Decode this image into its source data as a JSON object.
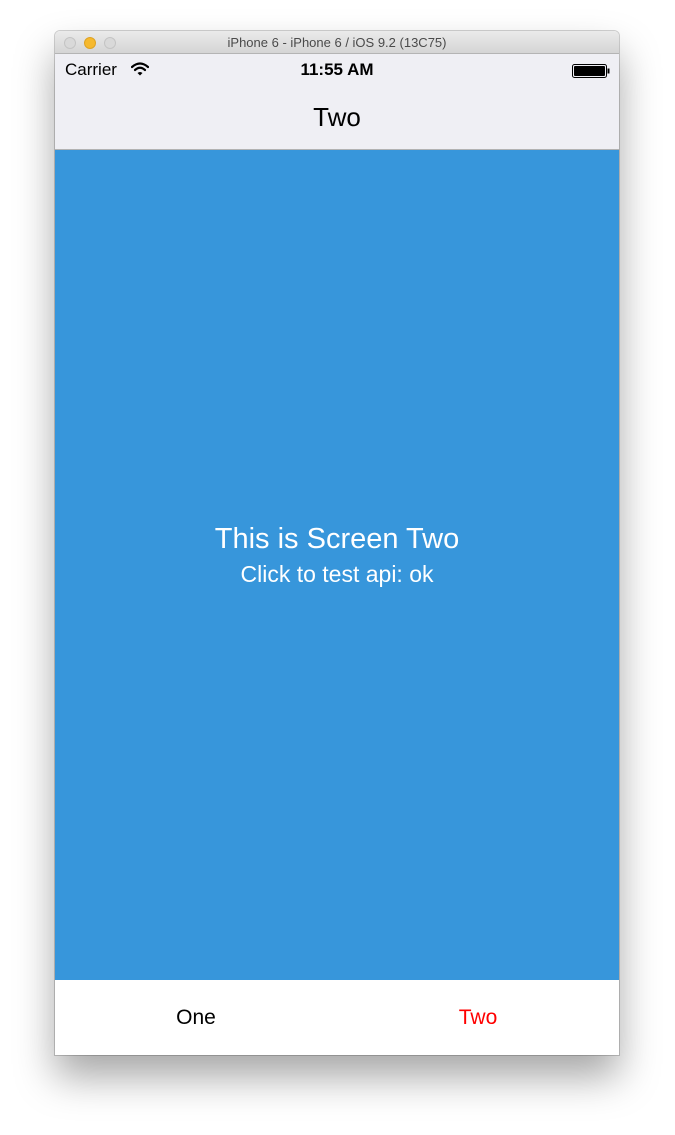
{
  "window": {
    "title": "iPhone 6 - iPhone 6 / iOS 9.2 (13C75)"
  },
  "status_bar": {
    "carrier": "Carrier",
    "time": "11:55 AM",
    "wifi_icon": "wifi-icon",
    "battery_icon": "battery-icon"
  },
  "nav": {
    "title": "Two",
    "background": "#efeff4"
  },
  "screen": {
    "title": "This is Screen Two",
    "api_text": "Click to test api: ok",
    "background": "#3796db",
    "text_color": "#ffffff"
  },
  "tabs": [
    {
      "label": "One",
      "color": "#000000",
      "selected": false
    },
    {
      "label": "Two",
      "color": "#ff0000",
      "selected": true
    }
  ]
}
